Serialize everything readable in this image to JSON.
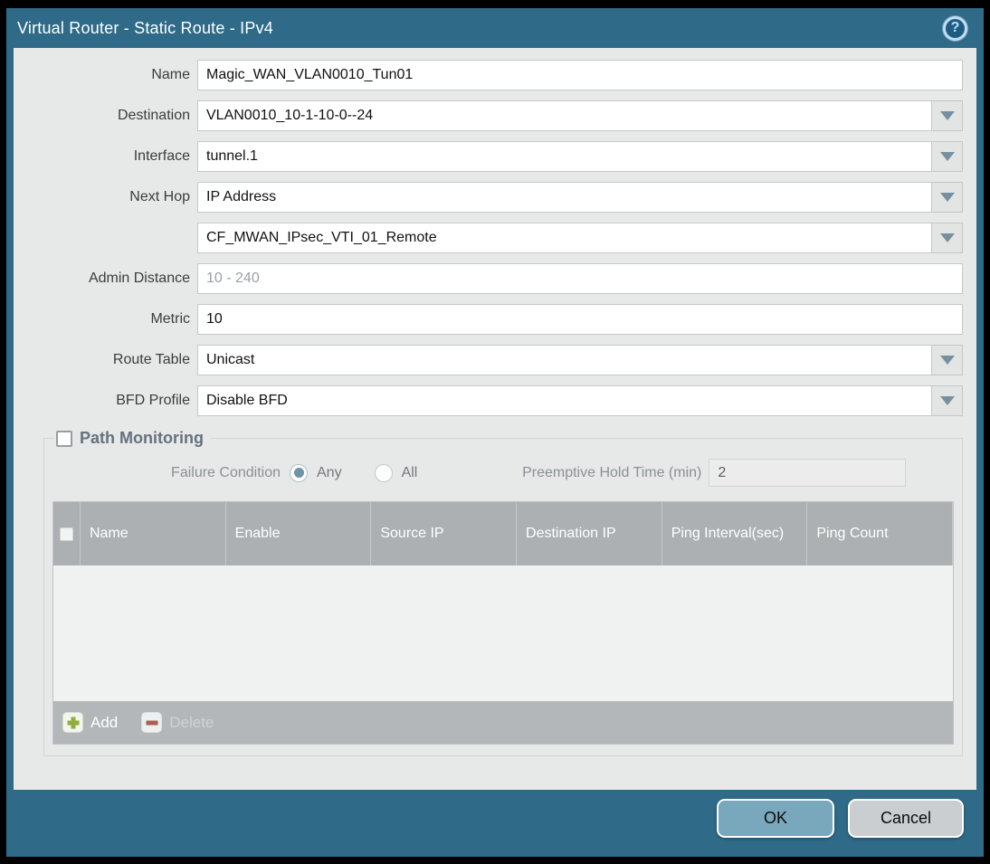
{
  "title_bar": {
    "title": "Virtual Router - Static Route - IPv4",
    "help_icon_glyph": "?"
  },
  "form": {
    "name": {
      "label": "Name",
      "value": "Magic_WAN_VLAN0010_Tun01"
    },
    "destination": {
      "label": "Destination",
      "value": "VLAN0010_10-1-10-0--24"
    },
    "interface": {
      "label": "Interface",
      "value": "tunnel.1"
    },
    "next_hop": {
      "label": "Next Hop",
      "value": "IP Address"
    },
    "next_hop_address": {
      "value": "CF_MWAN_IPsec_VTI_01_Remote"
    },
    "admin_distance": {
      "label": "Admin Distance",
      "placeholder": "10 - 240",
      "value": ""
    },
    "metric": {
      "label": "Metric",
      "value": "10"
    },
    "route_table": {
      "label": "Route Table",
      "value": "Unicast"
    },
    "bfd_profile": {
      "label": "BFD Profile",
      "value": "Disable BFD"
    }
  },
  "path_monitoring": {
    "title": "Path Monitoring",
    "checkbox_checked": false,
    "failure_condition": {
      "label": "Failure Condition",
      "options": [
        {
          "label": "Any",
          "selected": true
        },
        {
          "label": "All",
          "selected": false
        }
      ]
    },
    "preemptive_hold_time": {
      "label": "Preemptive Hold Time (min)",
      "value": "2",
      "disabled": true
    },
    "table": {
      "columns": [
        "Name",
        "Enable",
        "Source IP",
        "Destination IP",
        "Ping Interval(sec)",
        "Ping Count"
      ],
      "rows": []
    },
    "actions": {
      "add_label": "Add",
      "delete_label": "Delete",
      "delete_disabled": true
    }
  },
  "footer": {
    "ok_label": "OK",
    "cancel_label": "Cancel"
  },
  "colors": {
    "frame_teal": "#2F6B88",
    "body_bg": "#E7E8E8",
    "table_header_bg": "#ACB0B3",
    "table_footer_bg": "#B3B7BA",
    "ok_button_bg": "#79A7BC",
    "cancel_button_bg": "#CACED1",
    "radio_selected": "#6F94A6",
    "add_icon_green": "#8FAE3E",
    "delete_icon_red": "#A95F4E"
  }
}
